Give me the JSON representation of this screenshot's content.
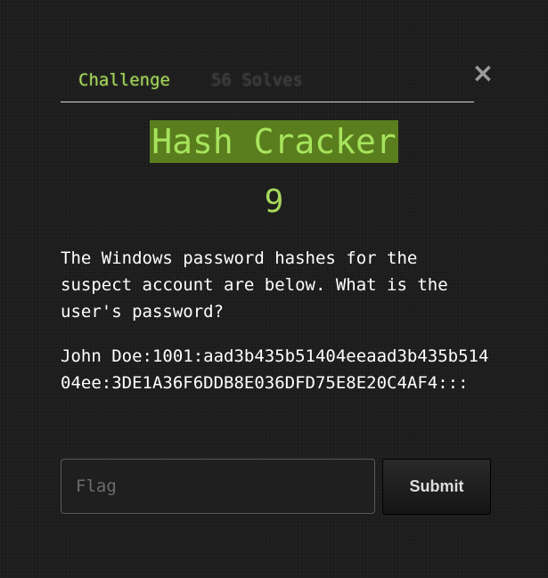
{
  "tabs": [
    {
      "label": "Challenge"
    },
    {
      "label": "56 Solves"
    }
  ],
  "close_glyph": "×",
  "challenge": {
    "title": "Hash Cracker",
    "points": "9",
    "description": "The Windows password hashes for the suspect account are below. What is the user's password?",
    "hash": "John Doe:1001:aad3b435b51404eeaad3b435b51404ee:3DE1A36F6DDB8E036DFD75E8E20C4AF4:::"
  },
  "form": {
    "flag_placeholder": "Flag",
    "flag_value": "",
    "submit_label": "Submit"
  },
  "colors": {
    "accent": "#a6d95a",
    "title_highlight": "#5a7d1e",
    "background": "#1c1c1c"
  }
}
